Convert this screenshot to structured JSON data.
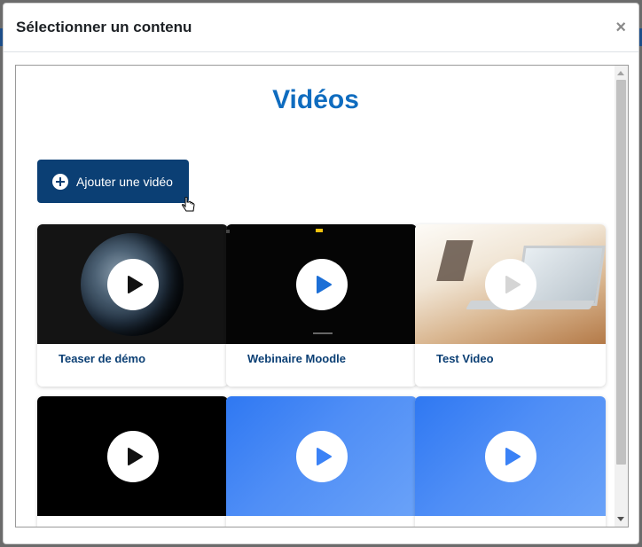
{
  "modal": {
    "title": "Sélectionner un contenu",
    "close_label": "×"
  },
  "page": {
    "heading": "Vidéos",
    "add_button_label": "Ajouter une vidéo"
  },
  "videos": [
    {
      "title": "Teaser de démo",
      "thumbnail": "earth"
    },
    {
      "title": "Webinaire Moodle",
      "thumbnail": "moodle-dark"
    },
    {
      "title": "Test Video",
      "thumbnail": "laptop"
    },
    {
      "title": "",
      "thumbnail": "black"
    },
    {
      "title": "",
      "thumbnail": "blue"
    },
    {
      "title": "",
      "thumbnail": "blue"
    }
  ],
  "colors": {
    "accent": "#0f6cbf",
    "button_bg": "#0b3f74",
    "card_title": "#0b3f74"
  },
  "icons": {
    "add": "plus-circle-icon",
    "play": "play-icon",
    "close": "close-icon",
    "cursor": "hand-cursor-icon"
  }
}
